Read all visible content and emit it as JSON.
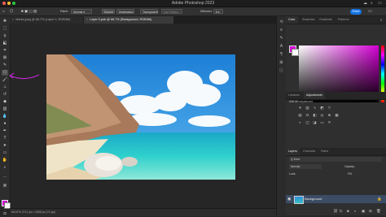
{
  "app": {
    "title": "Adobe Photoshop 2023"
  },
  "titlebar": {
    "traffic_colors": [
      "#ff5f57",
      "#febc2e",
      "#28c840"
    ]
  },
  "options": {
    "patch_label": "Patch:",
    "patch_value": "Normal",
    "source": "Source",
    "destination": "Destination",
    "transparent": "Transparent",
    "use_pattern": "Use Pattern",
    "diffusion_label": "Diffusion:",
    "diffusion_value": "5",
    "share": "Share"
  },
  "tabs": [
    {
      "label": "Marks.jpeg @ 66.7% (Layer 0, RGB/8#)"
    },
    {
      "label": "Layer 0.psb @ 66.7% (Background, RGB/8#)"
    }
  ],
  "status": {
    "text": "66.67%   2712 px x 1808 px (72 ppi)"
  },
  "panels": {
    "color_tabs": [
      "Color",
      "Swatches",
      "Gradients",
      "Patterns"
    ],
    "adj_tabs": [
      "Libraries",
      "Adjustments"
    ],
    "add_adjustment": "Add an adjustment",
    "layers_tabs": [
      "Layers",
      "Channels",
      "Paths"
    ],
    "kind": "Q Kind",
    "mode": "Normal",
    "opacity_label": "Opacity:",
    "lock_label": "Lock:",
    "fill_label": "Fill:",
    "layer_name": "Background"
  },
  "colors": {
    "foreground": "#d400d4",
    "background": "#ffffff",
    "accent": "#1473e6",
    "annotation": "#c026d3"
  }
}
